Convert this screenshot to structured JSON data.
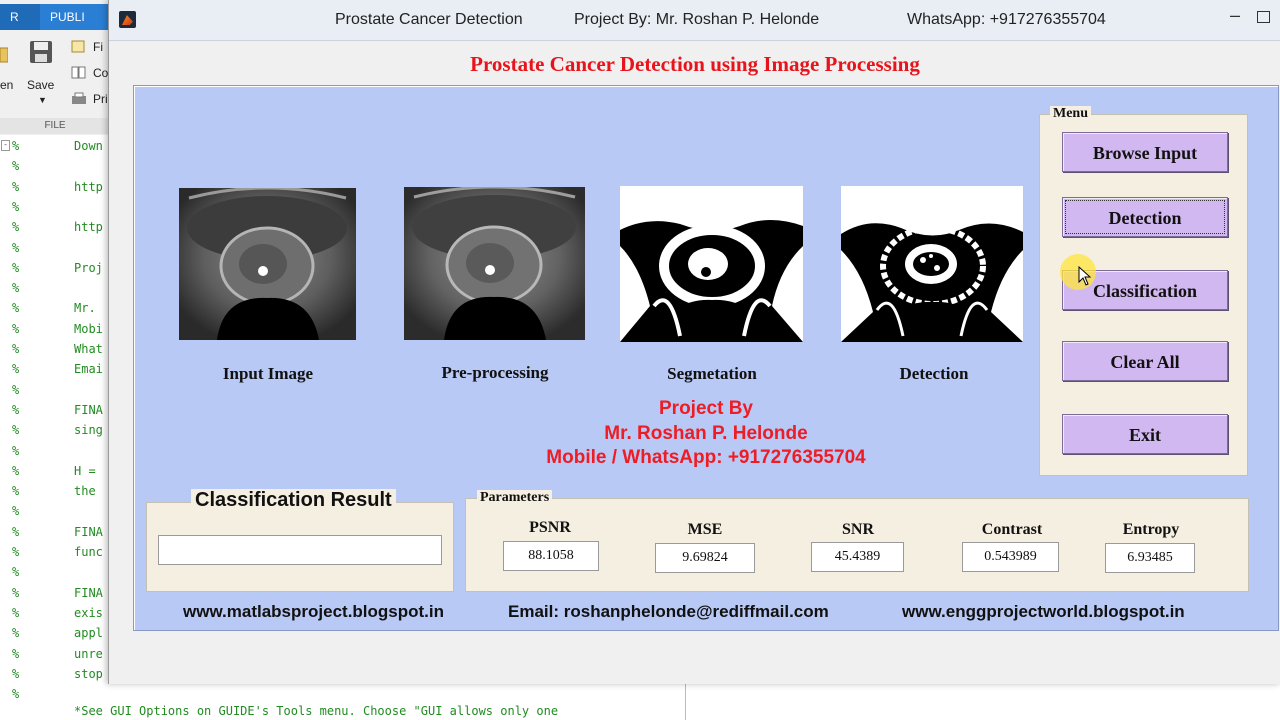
{
  "background_editor": {
    "tabs": [
      "R",
      "PUBLI"
    ],
    "tools": {
      "open_label": "en",
      "save_label": "Save",
      "find_label": "Fi",
      "compare_label": "Co",
      "print_label": "Pri",
      "section_label": "FILE"
    },
    "lines": [
      {
        "pct": "%",
        "text": "Down"
      },
      {
        "pct": "%",
        "text": ""
      },
      {
        "pct": "%",
        "text": "http"
      },
      {
        "pct": "%",
        "text": ""
      },
      {
        "pct": "%",
        "text": "http"
      },
      {
        "pct": "%",
        "text": ""
      },
      {
        "pct": "%",
        "text": "Proj"
      },
      {
        "pct": "%",
        "text": ""
      },
      {
        "pct": "%",
        "text": "Mr."
      },
      {
        "pct": "%",
        "text": "Mobi"
      },
      {
        "pct": "%",
        "text": "What"
      },
      {
        "pct": "%",
        "text": "Emai"
      },
      {
        "pct": "%",
        "text": ""
      },
      {
        "pct": "%",
        "text": "FINA"
      },
      {
        "pct": "%",
        "text": "sing"
      },
      {
        "pct": "%",
        "text": ""
      },
      {
        "pct": "%",
        "text": "H ="
      },
      {
        "pct": "%",
        "text": "the"
      },
      {
        "pct": "%",
        "text": ""
      },
      {
        "pct": "%",
        "text": "FINA"
      },
      {
        "pct": "%",
        "text": "func"
      },
      {
        "pct": "%",
        "text": ""
      },
      {
        "pct": "%",
        "text": "FINA"
      },
      {
        "pct": "%",
        "text": "exis"
      },
      {
        "pct": "%",
        "text": "appl"
      },
      {
        "pct": "%",
        "text": "unre"
      },
      {
        "pct": "%",
        "text": "stop"
      },
      {
        "pct": "%",
        "text": ""
      }
    ],
    "bottom_line": "*See GUI Options on GUIDE's Tools menu.  Choose \"GUI allows only one"
  },
  "window": {
    "app_title": "Prostate Cancer Detection",
    "project_by": "Project By: Mr. Roshan P. Helonde",
    "whatsapp": "WhatsApp: +917276355704",
    "minimize_glyph": "–"
  },
  "main_title": "Prostate Cancer Detection using Image Processing",
  "images": [
    {
      "label": "Input Image"
    },
    {
      "label": "Pre-processing"
    },
    {
      "label": "Segmetation"
    },
    {
      "label": "Detection"
    }
  ],
  "credits": {
    "line1": "Project By",
    "line2": "Mr. Roshan P. Helonde",
    "line3": "Mobile / WhatsApp: +917276355704"
  },
  "menu": {
    "title": "Menu",
    "buttons": {
      "browse": "Browse Input",
      "detection": "Detection",
      "classification": "Classification",
      "clear": "Clear All",
      "exit": "Exit"
    }
  },
  "classification": {
    "title": "Classification Result",
    "value": ""
  },
  "parameters": {
    "title": "Parameters",
    "psnr": {
      "label": "PSNR",
      "value": "88.1058"
    },
    "mse": {
      "label": "MSE",
      "value": "9.69824"
    },
    "snr": {
      "label": "SNR",
      "value": "45.4389"
    },
    "contrast": {
      "label": "Contrast",
      "value": "0.543989"
    },
    "entropy": {
      "label": "Entropy",
      "value": "6.93485"
    }
  },
  "footer": {
    "site1": "www.matlabsproject.blogspot.in",
    "email": "Email: roshanphelonde@rediffmail.com",
    "site2": "www.enggprojectworld.blogspot.in"
  },
  "colors": {
    "title_red": "#e8141b",
    "panel_blue": "#b9c9f6",
    "button_purple": "#d2b8f0",
    "group_beige": "#f5efe1",
    "editor_comment_green": "#228B22"
  }
}
